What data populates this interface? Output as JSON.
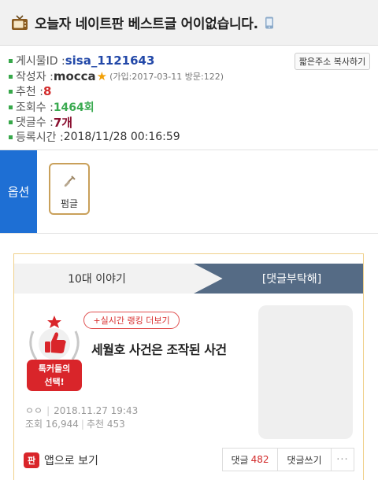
{
  "header": {
    "title": "오늘자 네이트판 베스트글 어이없습니다.",
    "icon_left": "tv-icon",
    "icon_right": "phone-icon"
  },
  "post_info": {
    "post_id_label": "게시물ID : ",
    "post_id": "sisa_1121643",
    "copy_button": "짧은주소 복사하기",
    "author_label": "작성자 : ",
    "author": "mocca",
    "author_star": "★",
    "author_meta": "(가입:2017-03-11 방문:122)",
    "recommend_label": "추천 : ",
    "recommend": "8",
    "views_label": "조회수 : ",
    "views": "1464회",
    "comments_label": "댓글수 : ",
    "comments": "7개",
    "date_label": "등록시간 : ",
    "date": "2018/11/28 00:16:59"
  },
  "options": {
    "label": "옵션",
    "scrap_label": "펌글"
  },
  "card": {
    "tab_left": "10대 이야기",
    "tab_right": "[댓글부탁해]",
    "ranking_button": "+실시간 랭킹 더보기",
    "badge_text_line1": "톡커들의",
    "badge_text_line2": "선택!",
    "headline": "세월호 사건은 조작된 사건",
    "author_masked": "ㅇㅇ",
    "date": "2018.11.27 19:43",
    "views": "조회 16,944",
    "recommends": "추천 453",
    "app_icon_text": "판",
    "app_view": "앱으로 보기",
    "comments_label": "댓글",
    "comments_count": "482",
    "write_comment": "댓글쓰기",
    "more": "···"
  },
  "colors": {
    "bullet": "#37a84a",
    "post_id": "#2248a8",
    "recommend": "#d22a2a",
    "views": "#3aaa50",
    "comments": "#8a1030",
    "options_bg": "#1e6fd4",
    "tab_active": "#556b85",
    "badge_red": "#d9252a"
  }
}
